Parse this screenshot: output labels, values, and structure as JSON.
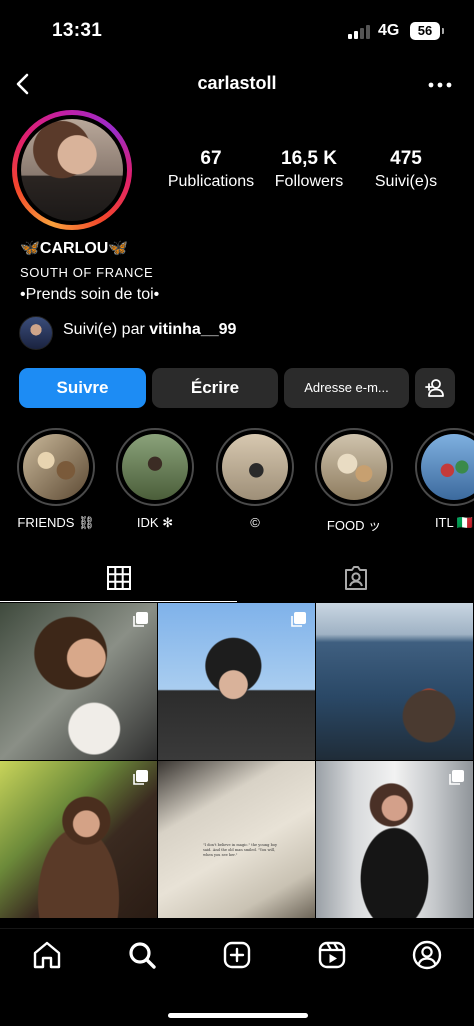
{
  "status_bar": {
    "time": "13:31",
    "network": "4G",
    "battery": "56"
  },
  "header": {
    "username": "carlastoll",
    "back_icon": "chevron-left-icon",
    "more_icon": "more-horizontal-icon"
  },
  "stats": [
    {
      "value": "67",
      "label": "Publications"
    },
    {
      "value": "16,5 K",
      "label": "Followers"
    },
    {
      "value": "475",
      "label": "Suivi(e)s"
    }
  ],
  "bio": {
    "name": "🦋CARLOU🦋",
    "line1": "SOUTH OF FRANCE",
    "line2": "•Prends soin de toi•"
  },
  "followed_by": {
    "prefix": "Suivi(e) par",
    "user": "vitinha__99"
  },
  "buttons": {
    "follow": "Suivre",
    "message": "Écrire",
    "email": "Adresse e-m...",
    "suggest_icon": "person-add-icon"
  },
  "highlights": [
    {
      "label": "FRIENDS ⛓"
    },
    {
      "label": "IDK ✻"
    },
    {
      "label": "©"
    },
    {
      "label": "FOOD ッ"
    },
    {
      "label": "ITL 🇮🇹"
    }
  ],
  "tabs": {
    "grid_icon": "grid-icon",
    "tagged_icon": "tagged-person-icon"
  },
  "posts_count_visible": 6,
  "book_quote": "\"I don't believe in magic.\" the young boy said. And the old man smiled. \"You will, when you see her.\"",
  "bottom_nav": [
    "home-icon",
    "search-icon",
    "create-icon",
    "reels-icon",
    "profile-icon"
  ],
  "colors": {
    "accent": "#1d8cf4",
    "button_bg": "#2b2b2b",
    "background": "#000000"
  }
}
